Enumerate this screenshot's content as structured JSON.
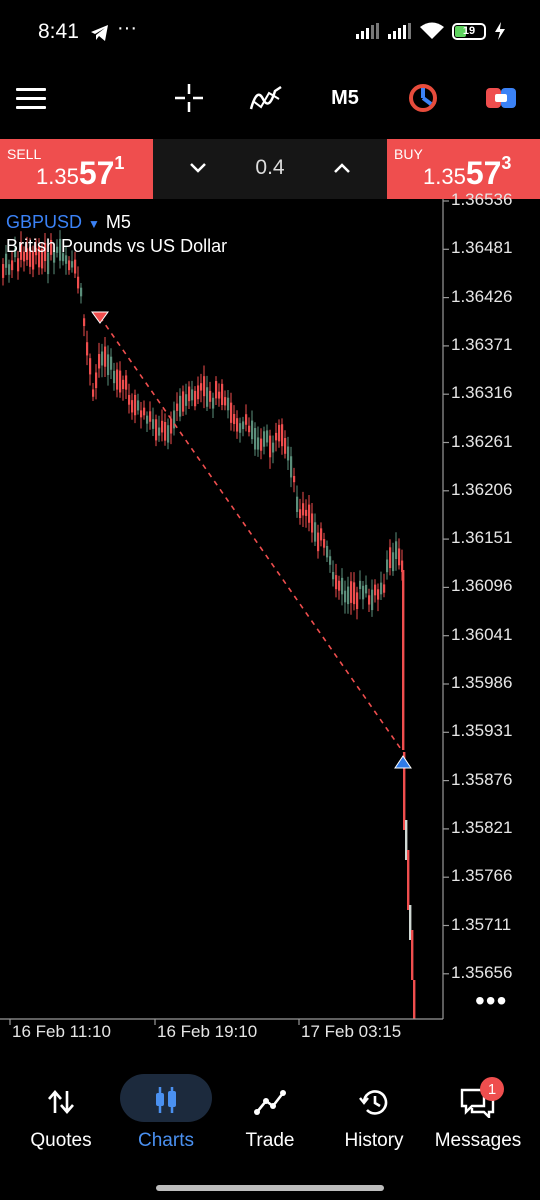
{
  "status_bar": {
    "time": "8:41",
    "battery": "19"
  },
  "toolbar": {
    "timeframe": "M5"
  },
  "trade": {
    "sell": {
      "label": "SELL",
      "price_prefix": "1.35",
      "price_big": "57",
      "price_sup": "1"
    },
    "buy": {
      "label": "BUY",
      "price_prefix": "1.35",
      "price_big": "57",
      "price_sup": "3"
    },
    "volume": "0.4"
  },
  "chart": {
    "symbol": "GBPUSD",
    "timeframe": "M5",
    "description": "British Pounds vs US Dollar",
    "price_labels": [
      "1.36536",
      "1.36481",
      "1.36426",
      "1.36371",
      "1.36316",
      "1.36261",
      "1.36206",
      "1.36151",
      "1.36096",
      "1.36041",
      "1.35986",
      "1.35931",
      "1.35876",
      "1.35821",
      "1.35766",
      "1.35711",
      "1.35656"
    ],
    "time_labels": [
      "16 Feb 11:10",
      "16 Feb 19:10",
      "17 Feb 03:15"
    ],
    "more": "•••",
    "colors": {
      "bull": "#5b8f7b",
      "bear": "#ef4e4e",
      "sell_marker": "#ef4e4e",
      "buy_marker": "#2f7be8",
      "symbol": "#3b82f6"
    }
  },
  "nav": {
    "items": [
      {
        "label": "Quotes",
        "icon": "quotes-icon"
      },
      {
        "label": "Charts",
        "icon": "charts-icon"
      },
      {
        "label": "Trade",
        "icon": "trade-icon"
      },
      {
        "label": "History",
        "icon": "history-icon"
      },
      {
        "label": "Messages",
        "icon": "messages-icon"
      }
    ],
    "active": "Charts",
    "active_color": "#4a90f0",
    "messages_badge": "1"
  }
}
